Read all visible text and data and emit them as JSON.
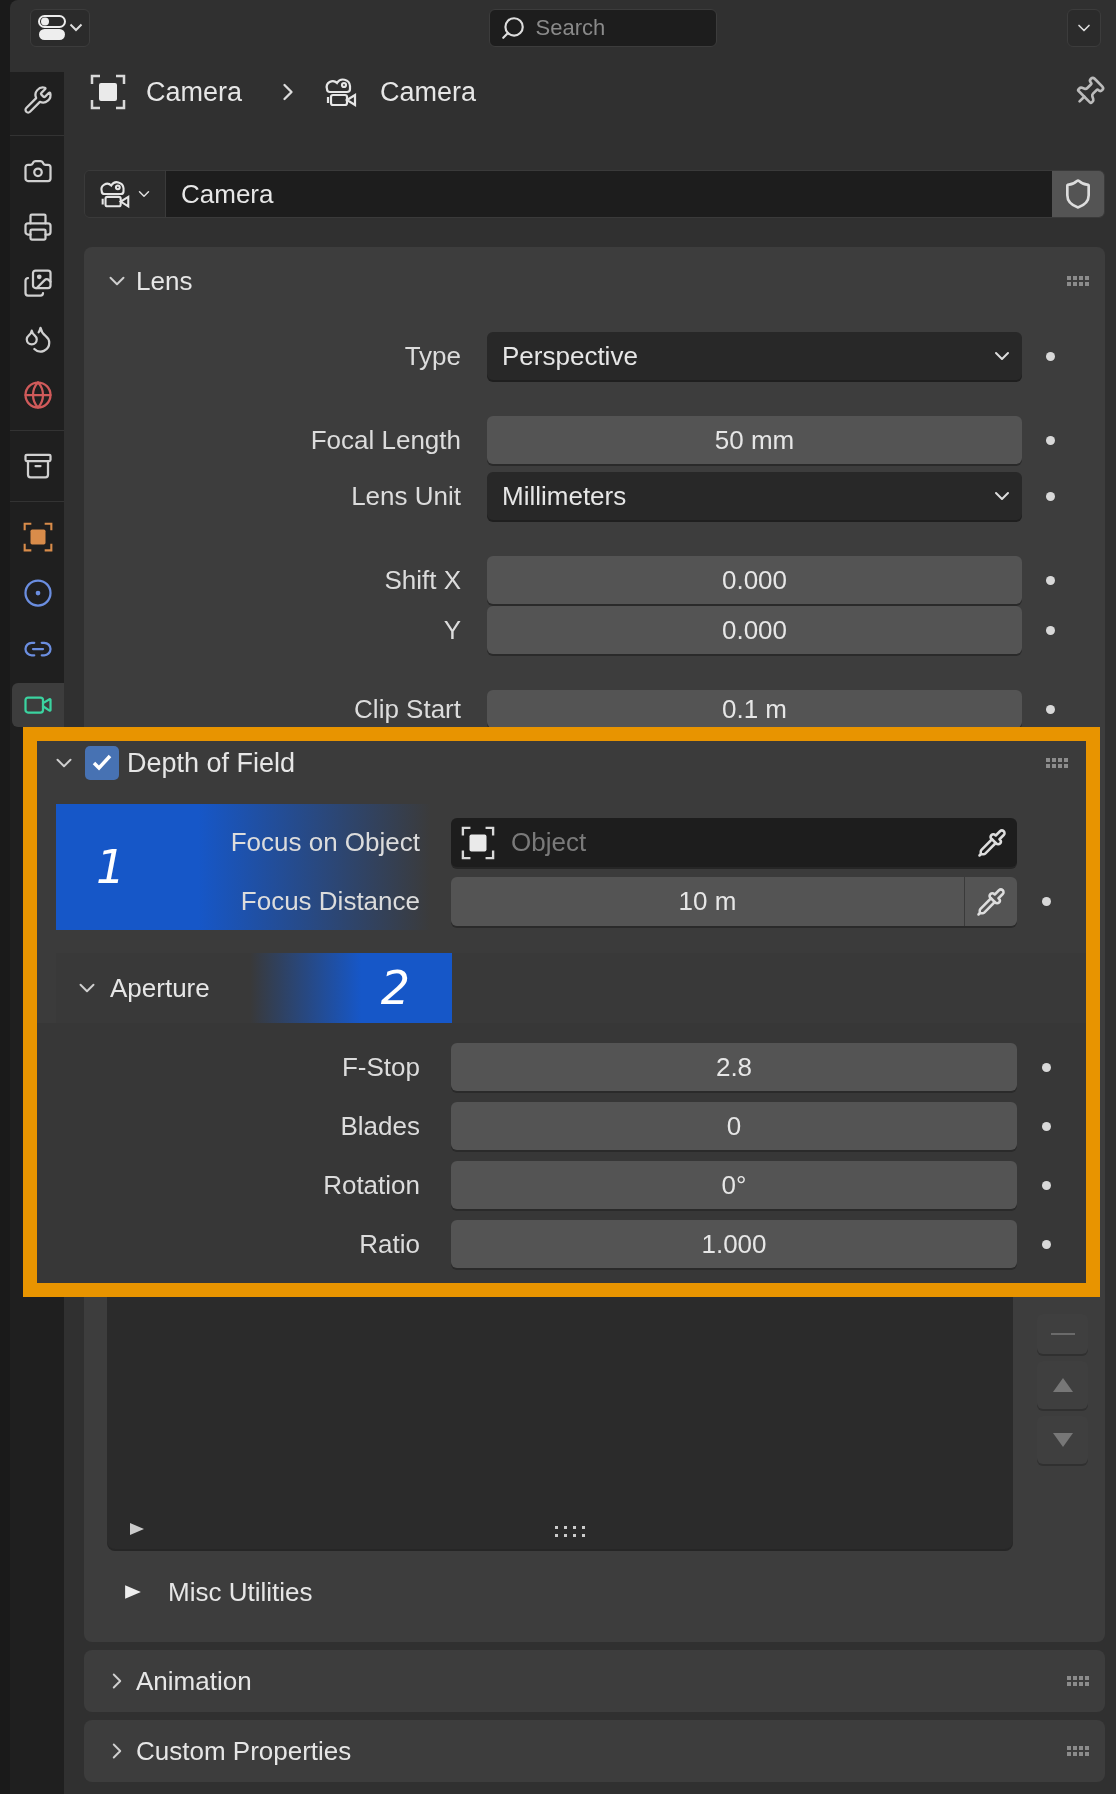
{
  "header": {
    "search": {
      "placeholder": "Search"
    }
  },
  "sidebar": {
    "tabs": [
      {
        "kind": "tool",
        "selected": false
      },
      {
        "kind": "render",
        "selected": false
      },
      {
        "kind": "output",
        "selected": false
      },
      {
        "kind": "view_layer",
        "selected": false
      },
      {
        "kind": "scene",
        "selected": false
      },
      {
        "kind": "world",
        "selected": false
      },
      {
        "kind": "collection",
        "selected": false
      },
      {
        "kind": "object",
        "selected": false
      },
      {
        "kind": "physics",
        "selected": false
      },
      {
        "kind": "constraints",
        "selected": false
      },
      {
        "kind": "camera_data",
        "selected": true
      }
    ]
  },
  "breadcrumb": [
    {
      "kind": "object",
      "label": "Camera"
    },
    {
      "kind": "camera",
      "label": "Camera"
    }
  ],
  "datablock": {
    "name": "Camera"
  },
  "lens": {
    "title": "Lens",
    "expanded": true,
    "groups": [
      {
        "rows": [
          {
            "label": "Type",
            "kind": "dropdown",
            "value": "Perspective",
            "animatable": true
          }
        ]
      },
      {
        "rows": [
          {
            "label": "Focal Length",
            "kind": "number",
            "value": "50 mm",
            "animatable": true
          },
          {
            "label": "Lens Unit",
            "kind": "dropdown",
            "value": "Millimeters",
            "animatable": true
          }
        ]
      },
      {
        "rows": [
          {
            "label": "Shift X",
            "kind": "number",
            "value": "0.000",
            "animatable": true
          },
          {
            "label": "Y",
            "kind": "number",
            "value": "0.000",
            "animatable": true
          }
        ]
      },
      {
        "rows": [
          {
            "label": "Clip Start",
            "kind": "number",
            "value": "0.1 m",
            "animatable": true
          }
        ]
      }
    ]
  },
  "depth_of_field": {
    "title": "Depth of Field",
    "enabled": true,
    "expanded": true,
    "rows": [
      {
        "label": "Focus on Object",
        "kind": "object",
        "placeholder": "Object",
        "animatable": false
      },
      {
        "label": "Focus Distance",
        "kind": "number_picker",
        "value": "10 m",
        "animatable": true
      }
    ],
    "aperture": {
      "title": "Aperture",
      "expanded": true,
      "rows": [
        {
          "label": "F-Stop",
          "value": "2.8",
          "animatable": true
        },
        {
          "label": "Blades",
          "value": "0",
          "animatable": true
        },
        {
          "label": "Rotation",
          "value": "0°",
          "animatable": true
        },
        {
          "label": "Ratio",
          "value": "1.000",
          "animatable": true
        }
      ]
    }
  },
  "annotations": [
    {
      "label": "1"
    },
    {
      "label": "2"
    }
  ],
  "misc_utilities": {
    "label": "Misc Utilities",
    "expanded": false
  },
  "panels": [
    {
      "title": "Animation",
      "expanded": false
    },
    {
      "title": "Custom Properties",
      "expanded": false
    }
  ]
}
